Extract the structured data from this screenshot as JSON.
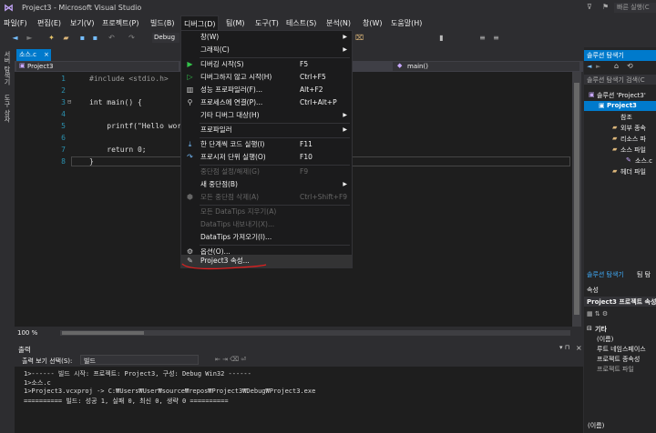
{
  "window": {
    "title": "Project3 - Microsoft Visual Studio",
    "quick_launch": "빠른 실행(C"
  },
  "menubar": [
    "파일(F)",
    "편집(E)",
    "보기(V)",
    "프로젝트(P)",
    "빌드(B)",
    "디버그(D)",
    "팀(M)",
    "도구(T)",
    "테스트(S)",
    "분석(N)",
    "창(W)",
    "도움말(H)"
  ],
  "toolbar": {
    "config": "Debug"
  },
  "left_strip": [
    "서버 탐색기",
    "도구 상자"
  ],
  "editor": {
    "tab": "소스.c",
    "nav_project": "Project3",
    "nav_function": "main()",
    "line_numbers": [
      "1",
      "2",
      "3",
      "4",
      "5",
      "6",
      "7",
      "8"
    ],
    "lines": [
      "#include <stdio.h>",
      "",
      "int main() {",
      "",
      "    printf(\"Hello wor",
      "",
      "    return 0;",
      "}"
    ],
    "zoom": "100 %"
  },
  "output": {
    "title": "출력",
    "source_label": "출력 보기 선택(S):",
    "source_value": "빌드",
    "lines": [
      "1>------ 빌드 시작: 프로젝트: Project3, 구성: Debug Win32 ------",
      "1>소스.c",
      "1>Project3.vcxproj -> C:₩Users₩User₩source₩repos₩Project3₩Debug₩Project3.exe",
      "========== 빌드: 성공 1, 실패 0, 최신 0, 생략 0 =========="
    ]
  },
  "solution_explorer": {
    "title": "솔루션 탐색기",
    "search": "솔루션 탐색기 검색(C",
    "items": [
      "솔루션 'Project3'",
      "Project3",
      "참조",
      "외부 종속",
      "리소스 파",
      "소스 파일",
      "소스.c",
      "헤더 파일"
    ],
    "bottom_tabs": [
      "솔루션 탐색기",
      "팀 탐"
    ]
  },
  "properties": {
    "title": "속성",
    "object": "Project3 프로젝트 속성",
    "category": "기타",
    "rows": [
      "(이름)",
      "루트 네임스페이스",
      "프로젝트 종속성",
      "프로젝트 파일"
    ],
    "footer": "(이름)"
  },
  "debug_menu": [
    {
      "label": "창(W)",
      "shortcut": "",
      "submenu": true,
      "disabled": false,
      "icon": ""
    },
    {
      "label": "그래픽(C)",
      "shortcut": "",
      "submenu": true,
      "disabled": false,
      "icon": ""
    },
    {
      "sep": true
    },
    {
      "label": "디버깅 시작(S)",
      "shortcut": "F5",
      "submenu": false,
      "disabled": false,
      "icon": "play-green"
    },
    {
      "label": "디버그하지 않고 시작(H)",
      "shortcut": "Ctrl+F5",
      "submenu": false,
      "disabled": false,
      "icon": "play-outline"
    },
    {
      "label": "성능 프로파일러(F)...",
      "shortcut": "Alt+F2",
      "submenu": false,
      "disabled": false,
      "icon": "chart"
    },
    {
      "label": "프로세스에 연결(P)...",
      "shortcut": "Ctrl+Alt+P",
      "submenu": false,
      "disabled": false,
      "icon": "attach"
    },
    {
      "label": "기타 디버그 대상(H)",
      "shortcut": "",
      "submenu": true,
      "disabled": false,
      "icon": ""
    },
    {
      "sep": true
    },
    {
      "label": "프로파일러",
      "shortcut": "",
      "submenu": true,
      "disabled": false,
      "icon": ""
    },
    {
      "sep": true
    },
    {
      "label": "한 단계씩 코드 실행(I)",
      "shortcut": "F11",
      "submenu": false,
      "disabled": false,
      "icon": "step-into"
    },
    {
      "label": "프로시저 단위 실행(O)",
      "shortcut": "F10",
      "submenu": false,
      "disabled": false,
      "icon": "step-over"
    },
    {
      "sep": true
    },
    {
      "label": "중단점 설정/해제(G)",
      "shortcut": "F9",
      "submenu": false,
      "disabled": true,
      "icon": ""
    },
    {
      "label": "새 중단점(B)",
      "shortcut": "",
      "submenu": true,
      "disabled": false,
      "icon": ""
    },
    {
      "label": "모든 중단점 삭제(A)",
      "shortcut": "Ctrl+Shift+F9",
      "submenu": false,
      "disabled": true,
      "icon": "breakpoints"
    },
    {
      "sep": true
    },
    {
      "label": "모든 DataTips 지우기(A)",
      "shortcut": "",
      "submenu": false,
      "disabled": true,
      "icon": ""
    },
    {
      "label": "DataTips 내보내기(X)...",
      "shortcut": "",
      "submenu": false,
      "disabled": true,
      "icon": ""
    },
    {
      "label": "DataTips 가져오기(I)...",
      "shortcut": "",
      "submenu": false,
      "disabled": false,
      "icon": ""
    },
    {
      "sep": true
    },
    {
      "label": "옵션(O)...",
      "shortcut": "",
      "submenu": false,
      "disabled": false,
      "icon": "gear"
    },
    {
      "label": "Project3 속성...",
      "shortcut": "",
      "submenu": false,
      "disabled": false,
      "icon": "wrench",
      "highlighted": true
    }
  ],
  "colors": {
    "accent": "#007acc",
    "annotation": "#e02020"
  }
}
